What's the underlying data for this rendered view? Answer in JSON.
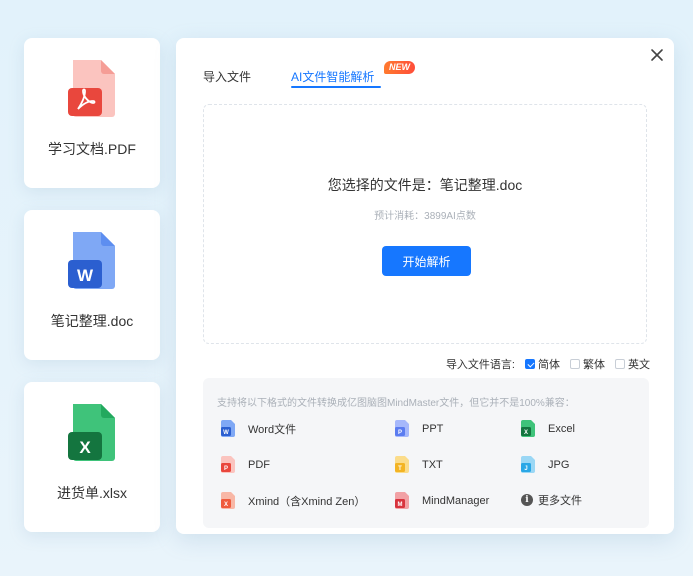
{
  "file_cards": [
    {
      "name": "学习文档.PDF",
      "type": "pdf",
      "color": "#e9473d",
      "glyph": "pdf-glyph"
    },
    {
      "name": "笔记整理.doc",
      "type": "word",
      "color": "#2b6de8",
      "glyph": "W"
    },
    {
      "name": "进货单.xlsx",
      "type": "excel",
      "color": "#1f9d55",
      "glyph": "X"
    }
  ],
  "panel": {
    "tabs": {
      "import_label": "导入文件",
      "ai_label": "AI文件智能解析",
      "badge": "NEW"
    },
    "dropzone": {
      "title": "您选择的文件是：笔记整理.doc",
      "cost": "预计消耗：3899AI点数",
      "start_button": "开始解析"
    },
    "language": {
      "label": "导入文件语言:",
      "options": [
        {
          "label": "简体",
          "checked": true
        },
        {
          "label": "繁体",
          "checked": false
        },
        {
          "label": "英文",
          "checked": false
        }
      ]
    },
    "formats": {
      "note": "支持将以下格式的文件转换成亿图脑图MindMaster文件，但它并不是100%兼容：",
      "items": [
        {
          "label": "Word文件",
          "icon": "word-icon",
          "color": "#2b6de8",
          "letter": "W"
        },
        {
          "label": "PPT",
          "icon": "ppt-icon",
          "color": "#5b7cf0",
          "letter": "P"
        },
        {
          "label": "Excel",
          "icon": "excel-icon",
          "color": "#1f9d55",
          "letter": "X"
        },
        {
          "label": "PDF",
          "icon": "pdf-icon",
          "color": "#e9473d",
          "letter": "P"
        },
        {
          "label": "TXT",
          "icon": "txt-icon",
          "color": "#f3b424",
          "letter": "T"
        },
        {
          "label": "JPG",
          "icon": "jpg-icon",
          "color": "#2aa7e6",
          "letter": "J"
        },
        {
          "label": "Xmind（含Xmind Zen）",
          "icon": "xmind-icon",
          "color": "#ef5b3d",
          "letter": "X"
        },
        {
          "label": "MindManager",
          "icon": "mindmanager-icon",
          "color": "#d8343e",
          "letter": "M"
        },
        {
          "label": "更多文件",
          "icon": "more-info-icon",
          "color": "#555555",
          "letter": "i"
        }
      ]
    }
  }
}
